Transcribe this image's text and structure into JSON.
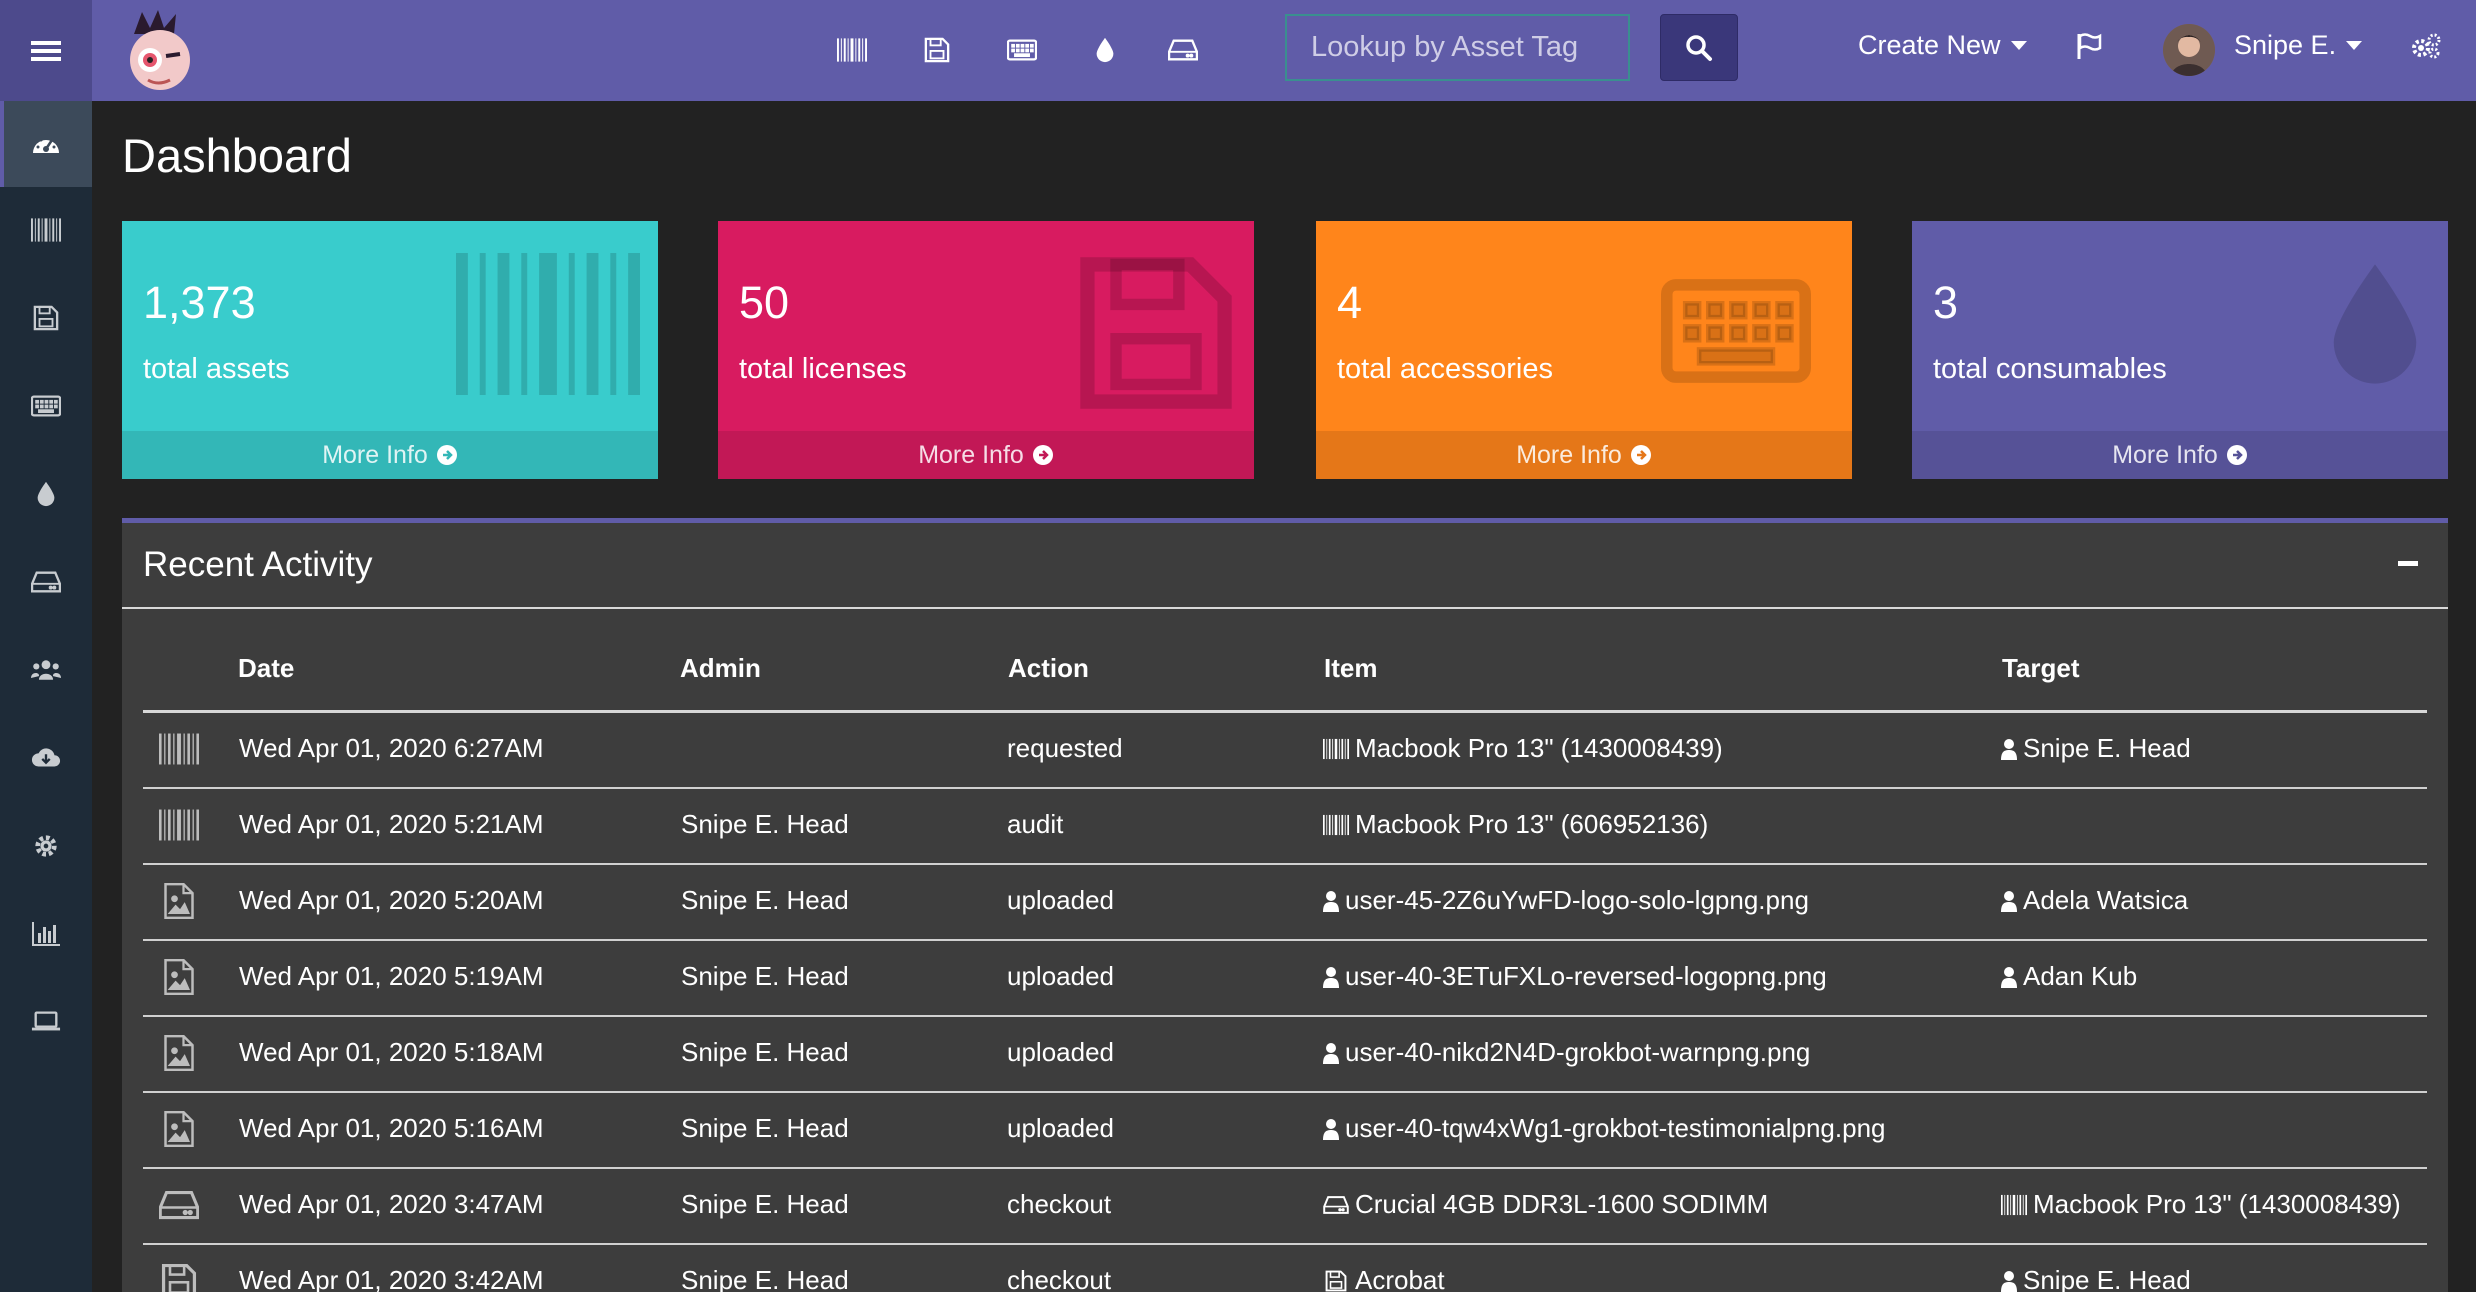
{
  "header": {
    "search_placeholder": "Lookup by Asset Tag",
    "create_new": "Create New",
    "user_name": "Snipe E."
  },
  "page": {
    "title": "Dashboard"
  },
  "stats": [
    {
      "count": "1,373",
      "label": "total assets",
      "more": "More Info",
      "color": "#39cccc",
      "icon": "barcode-icon"
    },
    {
      "count": "50",
      "label": "total licenses",
      "more": "More Info",
      "color": "#d81b60",
      "icon": "floppy-icon"
    },
    {
      "count": "4",
      "label": "total accessories",
      "more": "More Info",
      "color": "#ff851b",
      "icon": "keyboard-icon"
    },
    {
      "count": "3",
      "label": "total consumables",
      "more": "More Info",
      "color": "#605ca8",
      "icon": "tint-icon"
    }
  ],
  "activity": {
    "title": "Recent Activity",
    "columns": {
      "date": "Date",
      "admin": "Admin",
      "action": "Action",
      "item": "Item",
      "target": "Target"
    },
    "rows": [
      {
        "type_icon": "barcode-icon",
        "date": "Wed Apr 01, 2020 6:27AM",
        "admin": "",
        "action": "requested",
        "item_icon": "barcode-icon",
        "item": "Macbook Pro 13\" (1430008439)",
        "target_icon": "user-icon",
        "target": "Snipe E. Head"
      },
      {
        "type_icon": "barcode-icon",
        "date": "Wed Apr 01, 2020 5:21AM",
        "admin": "Snipe E. Head",
        "action": "audit",
        "item_icon": "barcode-icon",
        "item": "Macbook Pro 13\" (606952136)",
        "target_icon": "",
        "target": ""
      },
      {
        "type_icon": "image-file-icon",
        "date": "Wed Apr 01, 2020 5:20AM",
        "admin": "Snipe E. Head",
        "action": "uploaded",
        "item_icon": "user-icon",
        "item": "user-45-2Z6uYwFD-logo-solo-lgpng.png",
        "target_icon": "user-icon",
        "target": "Adela Watsica"
      },
      {
        "type_icon": "image-file-icon",
        "date": "Wed Apr 01, 2020 5:19AM",
        "admin": "Snipe E. Head",
        "action": "uploaded",
        "item_icon": "user-icon",
        "item": "user-40-3ETuFXLo-reversed-logopng.png",
        "target_icon": "user-icon",
        "target": "Adan Kub"
      },
      {
        "type_icon": "image-file-icon",
        "date": "Wed Apr 01, 2020 5:18AM",
        "admin": "Snipe E. Head",
        "action": "uploaded",
        "item_icon": "user-icon",
        "item": "user-40-nikd2N4D-grokbot-warnpng.png",
        "target_icon": "",
        "target": ""
      },
      {
        "type_icon": "image-file-icon",
        "date": "Wed Apr 01, 2020 5:16AM",
        "admin": "Snipe E. Head",
        "action": "uploaded",
        "item_icon": "user-icon",
        "item": "user-40-tqw4xWg1-grokbot-testimonialpng.png",
        "target_icon": "",
        "target": ""
      },
      {
        "type_icon": "hdd-icon",
        "date": "Wed Apr 01, 2020 3:47AM",
        "admin": "Snipe E. Head",
        "action": "checkout",
        "item_icon": "hdd-icon",
        "item": "Crucial 4GB DDR3L-1600 SODIMM",
        "target_icon": "barcode-icon",
        "target": "Macbook Pro 13\" (1430008439)"
      },
      {
        "type_icon": "floppy-icon",
        "date": "Wed Apr 01, 2020 3:42AM",
        "admin": "Snipe E. Head",
        "action": "checkout",
        "item_icon": "floppy-icon",
        "item": "Acrobat",
        "target_icon": "user-icon",
        "target": "Snipe E. Head"
      }
    ]
  }
}
